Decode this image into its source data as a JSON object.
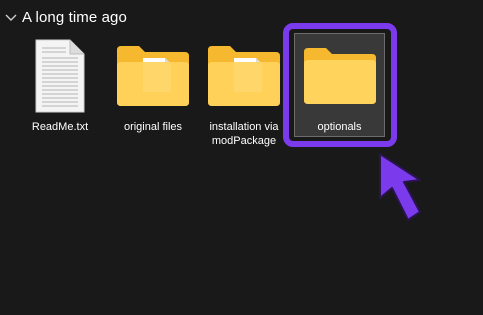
{
  "group": {
    "title": "A long time ago",
    "expanded_icon": "chevron-down-icon"
  },
  "items": [
    {
      "label": "ReadMe.txt",
      "icon": "text-file-icon"
    },
    {
      "label": "original files",
      "icon": "folder-with-document-icon"
    },
    {
      "label": "installation via modPackage",
      "icon": "folder-with-document-icon"
    },
    {
      "label": "optionals",
      "icon": "folder-icon",
      "selected": true
    }
  ],
  "annotation": {
    "ring_color": "#7c3aed",
    "arrow_color": "#7c3aed"
  },
  "colors": {
    "background": "#191919",
    "selection_fill": "#393939",
    "folder_yellow": "#ffd35c",
    "folder_back": "#f5b82e"
  }
}
